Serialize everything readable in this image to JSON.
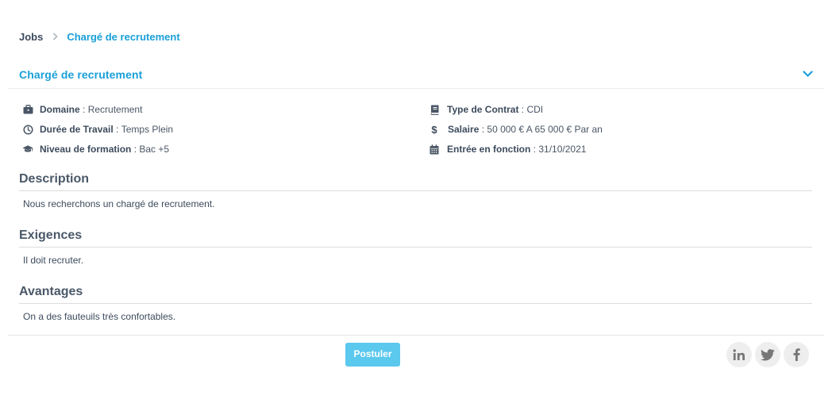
{
  "breadcrumb": {
    "root": "Jobs",
    "current": "Chargé de recrutement"
  },
  "panel": {
    "title": "Chargé de recrutement"
  },
  "info": {
    "domaine": {
      "key": "Domaine",
      "value": "Recrutement"
    },
    "duree": {
      "key": "Durée de Travail",
      "value": "Temps Plein"
    },
    "niveau": {
      "key": "Niveau de formation",
      "value": "Bac +5"
    },
    "contrat": {
      "key": "Type de Contrat",
      "value": "CDI"
    },
    "salaire": {
      "key": "Salaire",
      "value": "50 000 € A 65 000 € Par an"
    },
    "entree": {
      "key": "Entrée en fonction",
      "value": "31/10/2021"
    },
    "separator": " : "
  },
  "sections": {
    "description": {
      "title": "Description",
      "body": "Nous recherchons un chargé de recrutement."
    },
    "exigences": {
      "title": "Exigences",
      "body": "Il doit recruter."
    },
    "avantages": {
      "title": "Avantages",
      "body": "On a des fauteuils très confortables."
    }
  },
  "actions": {
    "apply_label": "Postuler"
  },
  "icons": {
    "breadcrumb_separator": "chevron-right-icon",
    "panel_toggle": "chevron-down-icon",
    "domaine": "briefcase-icon",
    "duree": "clock-icon",
    "niveau": "graduation-cap-icon",
    "contrat": "book-icon",
    "salaire": "dollar-icon",
    "entree": "calendar-icon",
    "share": [
      "linkedin-icon",
      "twitter-icon",
      "facebook-icon"
    ]
  },
  "colors": {
    "accent": "#1aa0d8",
    "button": "#5bc8ee",
    "text": "#3d4b5c",
    "social_bg": "#eeeeee"
  }
}
